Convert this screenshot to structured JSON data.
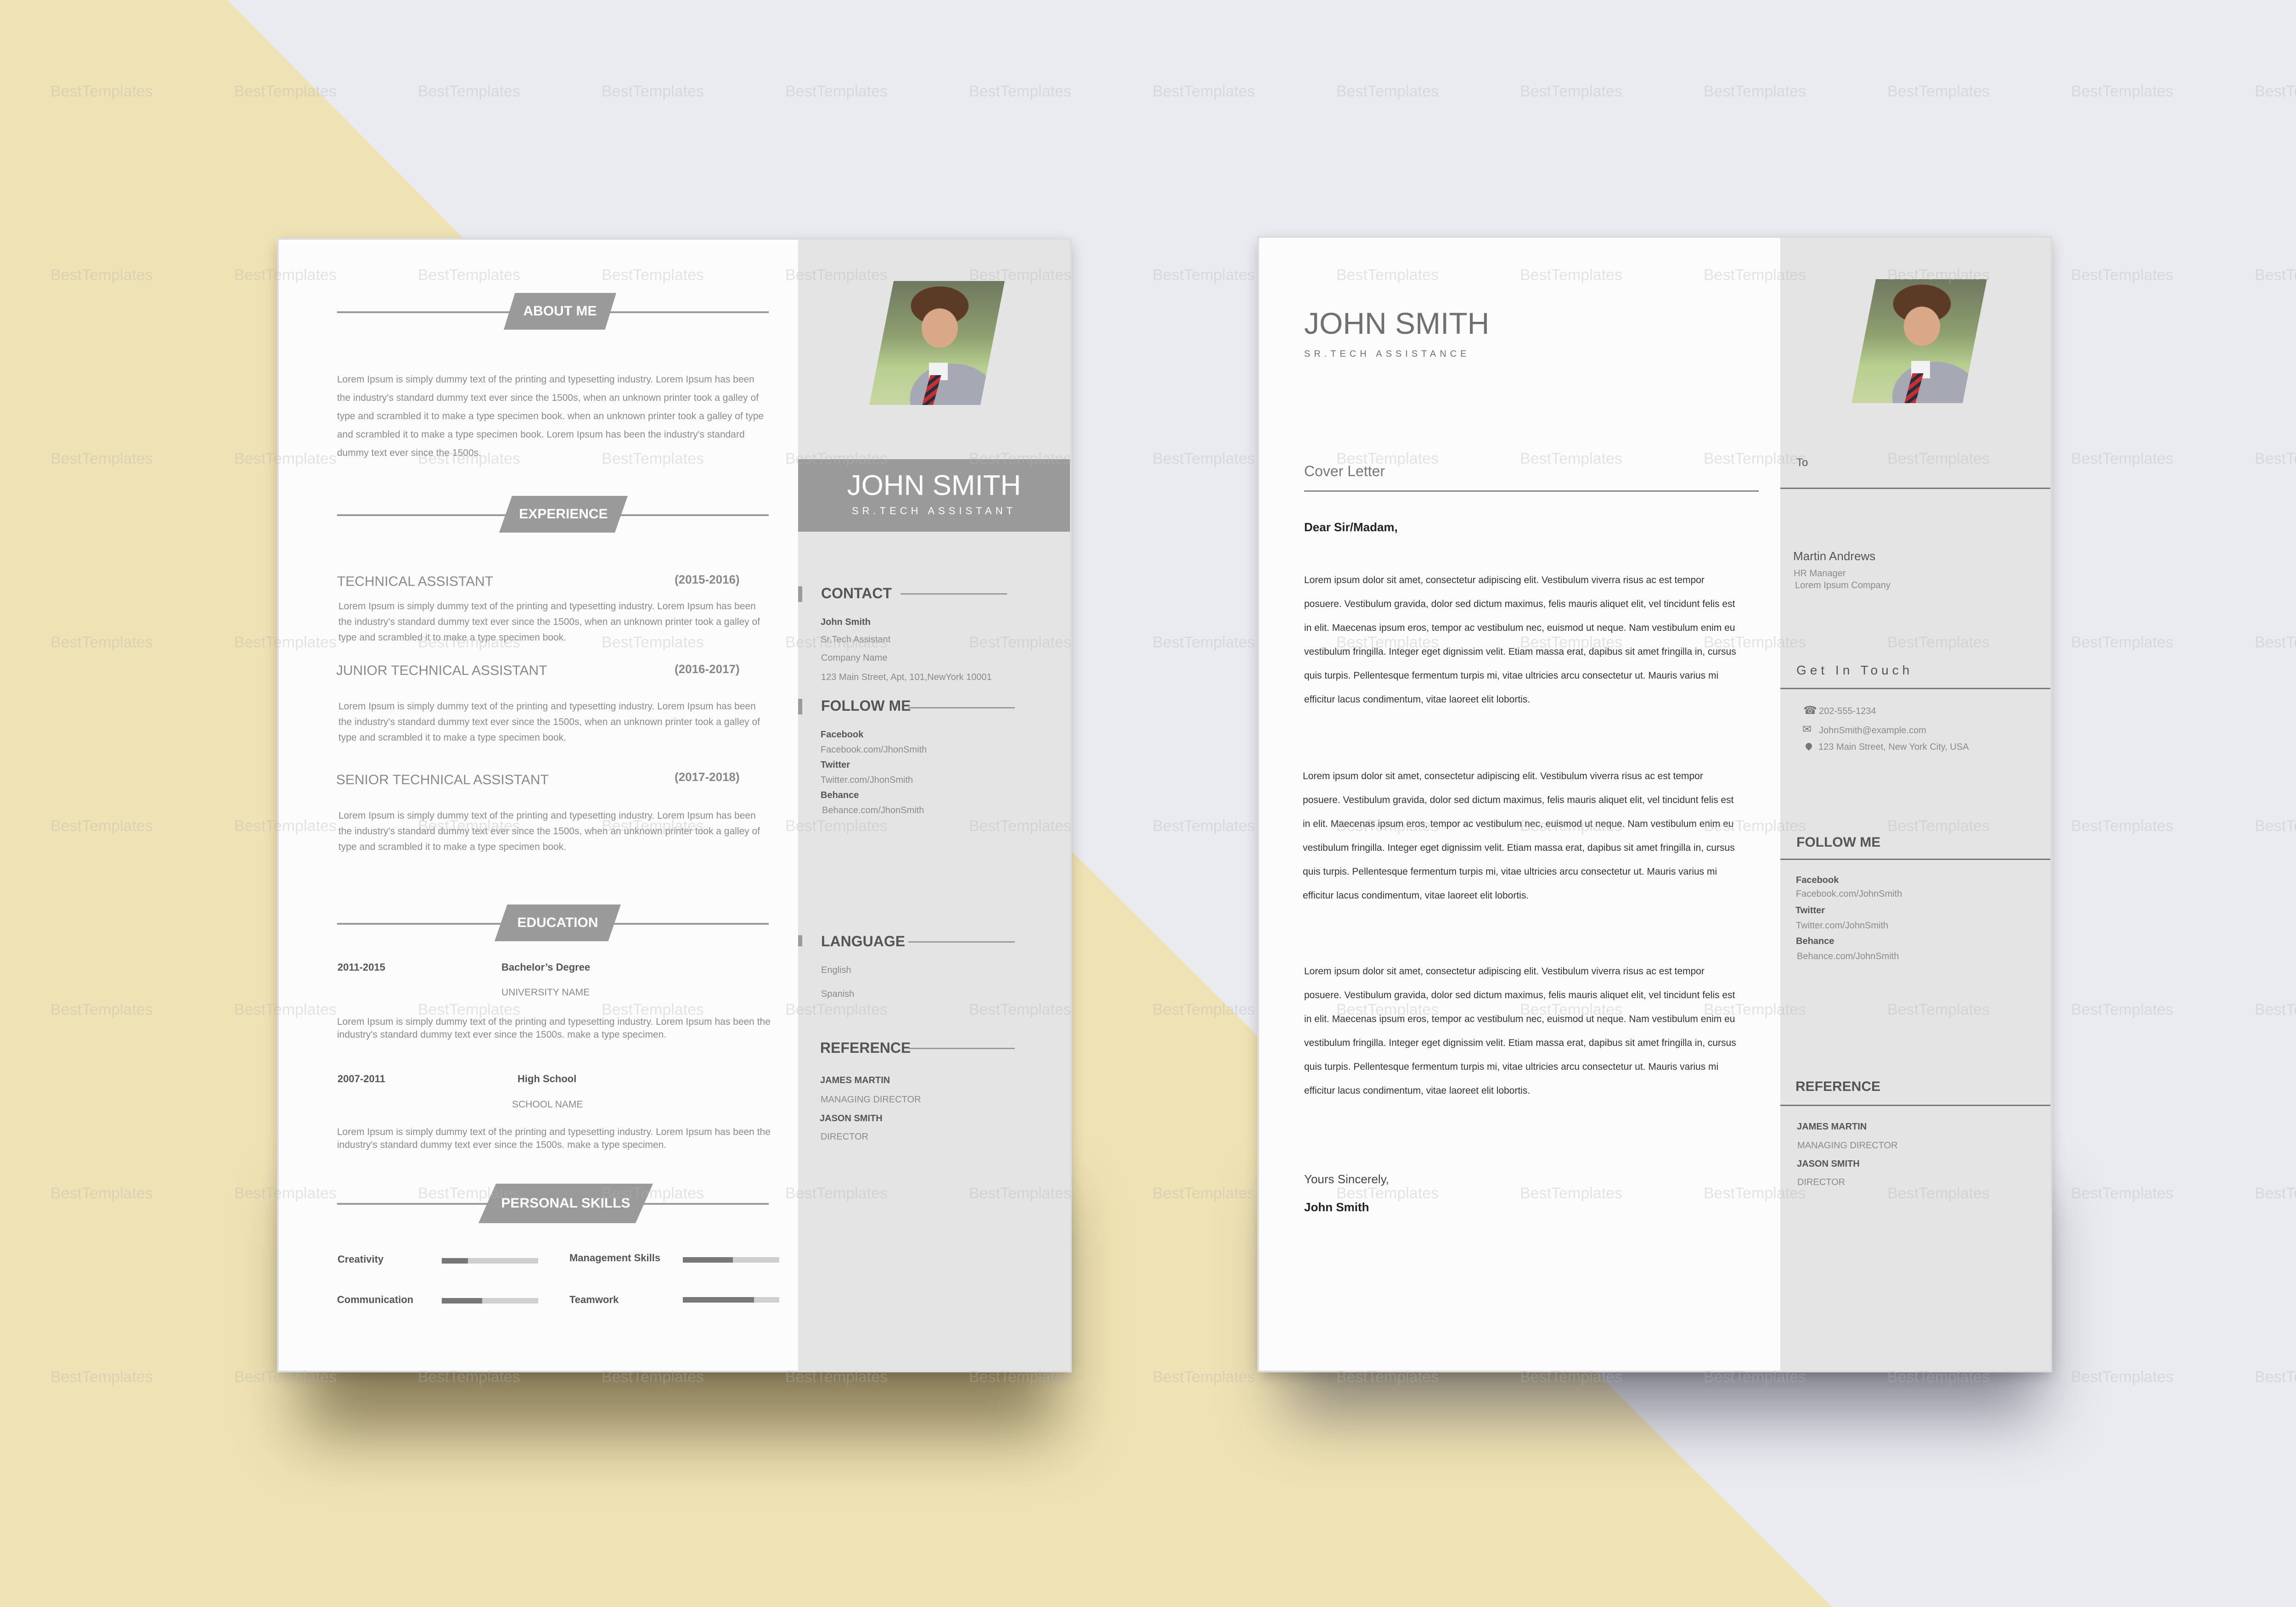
{
  "colors": {
    "background_yellow": "#efe2b4",
    "background_grey": "#eaebf0",
    "sidebar": "#e4e4e4",
    "accent_grey": "#9a9a9a",
    "skill_fill": "#777777",
    "skill_track": "#cfcfcf"
  },
  "watermark": "BestTemplates",
  "resume": {
    "sections": {
      "about": "ABOUT ME",
      "experience": "EXPERIENCE",
      "education": "EDUCATION",
      "skills": "PERSONAL SKILLS"
    },
    "about_text": "Lorem Ipsum is simply dummy text of the printing and typesetting industry. Lorem Ipsum has been the industry's standard dummy text ever since the 1500s, when an unknown printer took a galley of type and scrambled it to make a type specimen book. when an unknown printer took a galley of type and scrambled it to make a type specimen book. Lorem Ipsum has been the industry's standard dummy text ever since the 1500s.",
    "experience": [
      {
        "title": "TECHNICAL ASSISTANT",
        "years": "(2015-2016)",
        "text": "Lorem Ipsum is simply dummy text of the printing and typesetting industry. Lorem Ipsum has been the industry's standard dummy text ever since the 1500s, when an unknown printer took a galley of type and scrambled it to make a type specimen book."
      },
      {
        "title": "JUNIOR TECHNICAL ASSISTANT",
        "years": "(2016-2017)",
        "text": "Lorem Ipsum is simply dummy text of the printing and typesetting industry. Lorem Ipsum has been the industry's standard dummy text ever since the 1500s, when an unknown printer took a galley of type and scrambled it to make a type specimen book."
      },
      {
        "title": "SENIOR TECHNICAL ASSISTANT",
        "years": "(2017-2018)",
        "text": "Lorem Ipsum is simply dummy text of the printing and typesetting industry. Lorem Ipsum has been the industry's standard dummy text ever since the 1500s, when an unknown printer took a galley of type and scrambled it to make a type specimen book."
      }
    ],
    "education": [
      {
        "years": "2011-2015",
        "degree": "Bachelor’s Degree",
        "school": "UNIVERSITY NAME",
        "text": "Lorem Ipsum is simply dummy text of the printing and typesetting industry. Lorem Ipsum has been the industry's standard dummy text ever since the 1500s. make a type specimen."
      },
      {
        "years": "2007-2011",
        "degree": "High School",
        "school": "SCHOOL NAME",
        "text": "Lorem Ipsum is simply dummy text of the printing and typesetting industry. Lorem Ipsum has been the industry's standard dummy text ever since the 1500s. make a type specimen."
      }
    ],
    "skills": [
      {
        "name": "Creativity",
        "level": 0.27
      },
      {
        "name": "Management Skills",
        "level": 0.52
      },
      {
        "name": "Communication",
        "level": 0.42
      },
      {
        "name": "Teamwork",
        "level": 0.74
      }
    ],
    "sidebar": {
      "name": "JOHN SMITH",
      "title": "SR.TECH ASSISTANT",
      "contact_heading": "CONTACT",
      "contact": [
        "John Smith",
        "Sr.Tech Assistant",
        "Company Name",
        "123 Main Street, Apt, 101,NewYork 10001"
      ],
      "follow_heading": "FOLLOW ME",
      "follow": [
        {
          "label": "Facebook",
          "value": "Facebook.com/JhonSmith"
        },
        {
          "label": "Twitter",
          "value": "Twitter.com/JhonSmith"
        },
        {
          "label": "Behance",
          "value": "Behance.com/JhonSmith"
        }
      ],
      "language_heading": "LANGUAGE",
      "languages": [
        "English",
        "Spanish"
      ],
      "reference_heading": "REFERENCE",
      "references": [
        {
          "name": "JAMES MARTIN",
          "role": "MANAGING DIRECTOR"
        },
        {
          "name": "JASON SMITH",
          "role": "DIRECTOR"
        }
      ]
    }
  },
  "cover": {
    "name": "JOHN SMITH",
    "title": "SR.TECH ASSISTANCE",
    "heading": "Cover Letter",
    "salutation": "Dear Sir/Madam,",
    "paragraphs": [
      "Lorem ipsum dolor sit amet, consectetur adipiscing elit. Vestibulum viverra risus ac est tempor posuere. Vestibulum gravida, dolor sed dictum maximus, felis mauris aliquet elit, vel tincidunt felis est in elit. Maecenas ipsum eros, tempor ac vestibulum nec, euismod ut neque. Nam vestibulum enim eu vestibulum fringilla. Integer eget dignissim velit. Etiam massa erat, dapibus sit amet fringilla in, cursus quis turpis. Pellentesque fermentum turpis mi, vitae ultricies arcu consectetur ut. Mauris varius mi efficitur lacus condimentum, vitae laoreet elit lobortis.",
      "Lorem ipsum dolor sit amet, consectetur adipiscing elit. Vestibulum viverra risus ac est tempor posuere. Vestibulum gravida, dolor sed dictum maximus, felis mauris aliquet elit, vel tincidunt felis est in elit. Maecenas ipsum eros, tempor ac vestibulum nec, euismod ut neque. Nam vestibulum enim eu vestibulum fringilla. Integer eget dignissim velit. Etiam massa erat, dapibus sit amet fringilla in, cursus quis turpis. Pellentesque fermentum turpis mi, vitae ultricies arcu consectetur ut. Mauris varius mi efficitur lacus condimentum, vitae laoreet elit lobortis.",
      "Lorem ipsum dolor sit amet, consectetur adipiscing elit. Vestibulum viverra risus ac est tempor posuere. Vestibulum gravida, dolor sed dictum maximus, felis mauris aliquet elit, vel tincidunt felis est in elit. Maecenas ipsum eros, tempor ac vestibulum nec, euismod ut neque. Nam vestibulum enim eu vestibulum fringilla. Integer eget dignissim velit. Etiam massa erat, dapibus sit amet fringilla in, cursus quis turpis. Pellentesque fermentum turpis mi, vitae ultricies arcu consectetur ut. Mauris varius mi efficitur lacus condimentum, vitae laoreet elit lobortis."
    ],
    "closing": "Yours Sincerely,",
    "signature": "John Smith",
    "sidebar": {
      "to_label": "To",
      "recipient_name": "Martin Andrews",
      "recipient_role": "HR Manager",
      "recipient_company": "Lorem Ipsum Company",
      "touch_heading": "Get In Touch",
      "phone": "202-555-1234",
      "email": "JohnSmith@example.com",
      "address": "123 Main Street, New York City, USA",
      "follow_heading": "FOLLOW ME",
      "follow": [
        {
          "label": "Facebook",
          "value": "Facebook.com/JohnSmith"
        },
        {
          "label": "Twitter",
          "value": "Twitter.com/JohnSmith"
        },
        {
          "label": "Behance",
          "value": "Behance.com/JohnSmith"
        }
      ],
      "reference_heading": "REFERENCE",
      "references": [
        {
          "name": "JAMES MARTIN",
          "role": "MANAGING DIRECTOR"
        },
        {
          "name": "JASON SMITH",
          "role": "DIRECTOR"
        }
      ]
    }
  }
}
